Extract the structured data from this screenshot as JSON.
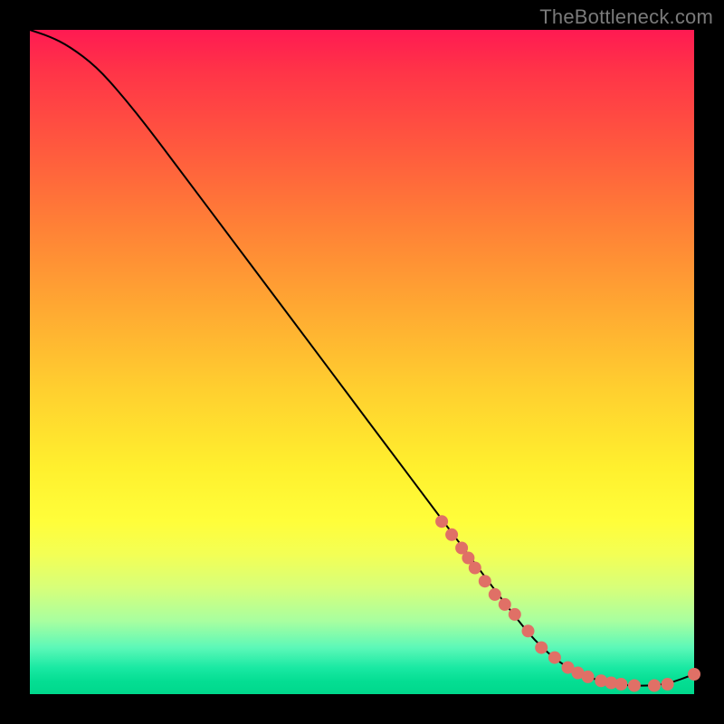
{
  "attribution": "TheBottleneck.com",
  "colors": {
    "gradient_top": "#ff1a52",
    "gradient_mid": "#ffcf2f",
    "gradient_bottom": "#00d88c",
    "curve": "#000000",
    "marker": "#e07066",
    "page_bg": "#000000"
  },
  "chart_data": {
    "type": "line",
    "title": "",
    "xlabel": "",
    "ylabel": "",
    "xlim": [
      0,
      100
    ],
    "ylim": [
      0,
      100
    ],
    "grid": false,
    "legend": false,
    "series": [
      {
        "name": "bottleneck-curve",
        "x": [
          0,
          3,
          6,
          10,
          14,
          18,
          24,
          30,
          36,
          42,
          48,
          54,
          60,
          66,
          72,
          76,
          80,
          84,
          88,
          92,
          96,
          100
        ],
        "y": [
          100,
          99,
          97.5,
          94.5,
          90,
          85,
          77,
          69,
          61,
          53,
          45,
          37,
          29,
          21,
          13,
          8,
          4.5,
          2.5,
          1.5,
          1.2,
          1.5,
          3
        ]
      }
    ],
    "markers": {
      "name": "highlight-points",
      "x": [
        62,
        63.5,
        65,
        66,
        67,
        68.5,
        70,
        71.5,
        73,
        75,
        77,
        79,
        81,
        82.5,
        84,
        86,
        87.5,
        89,
        91,
        94,
        96,
        100
      ],
      "y": [
        26,
        24,
        22,
        20.5,
        19,
        17,
        15,
        13.5,
        12,
        9.5,
        7,
        5.5,
        4,
        3.2,
        2.6,
        2,
        1.7,
        1.5,
        1.3,
        1.3,
        1.5,
        3
      ]
    }
  }
}
